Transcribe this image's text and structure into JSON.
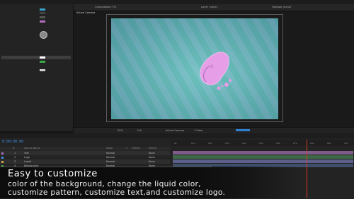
{
  "comp_tabs": [
    "Composition: Fill",
    "Layer (none)",
    "Footage (none)"
  ],
  "viewer_label": "Active Camera",
  "viewer_footer": {
    "zoom": "50%",
    "resolution": "Full",
    "camera": "Active Camera",
    "view": "1 View"
  },
  "timeline": {
    "timecode": "0:00:00:00",
    "header": [
      "#",
      "Source Name",
      "Mode",
      "T",
      "TrkMat",
      "Parent"
    ],
    "layers": [
      {
        "num": "1",
        "name": "Text",
        "mode": "Normal",
        "parent": "None"
      },
      {
        "num": "2",
        "name": "Logo",
        "mode": "Normal",
        "parent": "None"
      },
      {
        "num": "3",
        "name": "Liquid",
        "mode": "Normal",
        "parent": "None"
      },
      {
        "num": "4",
        "name": "Background",
        "mode": "Normal",
        "parent": "None"
      }
    ],
    "ruler": [
      "0s",
      "01s",
      "02s",
      "03s",
      "04s",
      "05s",
      "06s",
      "07s",
      "08s",
      "09s",
      "10s"
    ]
  },
  "caption": {
    "title": "Easy to customize",
    "line1": "color of the background, change the liquid color,",
    "line2": "customize pattern, customize text,and customize logo."
  },
  "colors": {
    "accent": "#2d7fd0",
    "liquid": "#e08fe0",
    "background_a": "#62b6b6",
    "background_b": "#7ab9c7"
  }
}
